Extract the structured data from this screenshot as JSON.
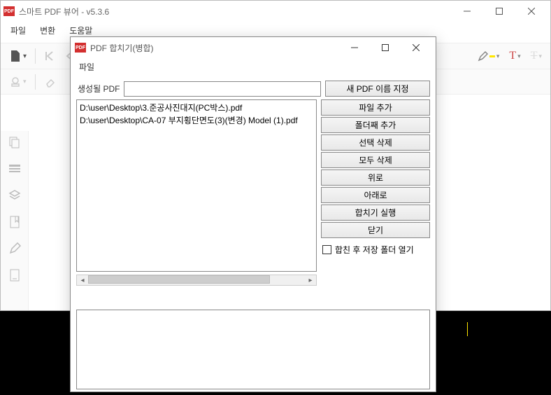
{
  "main": {
    "title": "스마트 PDF 뷰어 - v5.3.6",
    "menu": [
      "파일",
      "변환",
      "도움말"
    ]
  },
  "dialog": {
    "title": "PDF 합치기(병합)",
    "menu": [
      "파일"
    ],
    "gen_label": "생성될 PDF",
    "gen_value": "",
    "new_name_btn": "새 PDF 이름 지정",
    "files": [
      "D:\\user\\Desktop\\3.준공사진대지(PC박스).pdf",
      "D:\\user\\Desktop\\CA-07 부지횡단면도(3)(변경) Model (1).pdf"
    ],
    "buttons": {
      "add_file": "파일 추가",
      "add_folder": "폴더째 추가",
      "del_sel": "선택 삭제",
      "del_all": "모두 삭제",
      "up": "위로",
      "down": "아래로",
      "merge": "합치기 실행",
      "close": "닫기"
    },
    "chk_label": "합친 후 저장 폴더 열기"
  }
}
